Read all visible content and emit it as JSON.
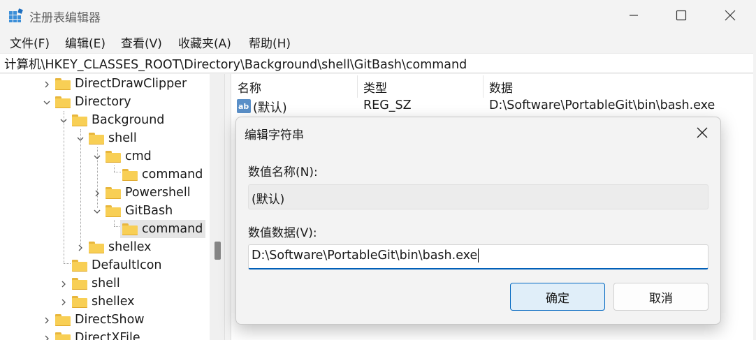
{
  "window": {
    "title": "注册表编辑器",
    "menu": [
      "文件(F)",
      "编辑(E)",
      "查看(V)",
      "收藏夹(A)",
      "帮助(H)"
    ],
    "address": "计算机\\HKEY_CLASSES_ROOT\\Directory\\Background\\shell\\GitBash\\command",
    "icons": {
      "app": "registry-editor-icon",
      "minimize": "minimize-icon",
      "maximize": "maximize-icon",
      "close": "close-icon"
    }
  },
  "tree": {
    "items": [
      {
        "label": "DirectDrawClipper",
        "depth": 0,
        "expander": "collapsed"
      },
      {
        "label": "Directory",
        "depth": 0,
        "expander": "expanded"
      },
      {
        "label": "Background",
        "depth": 1,
        "expander": "expanded"
      },
      {
        "label": "shell",
        "depth": 2,
        "expander": "expanded"
      },
      {
        "label": "cmd",
        "depth": 3,
        "expander": "expanded"
      },
      {
        "label": "command",
        "depth": 4,
        "expander": "none"
      },
      {
        "label": "Powershell",
        "depth": 3,
        "expander": "collapsed"
      },
      {
        "label": "GitBash",
        "depth": 3,
        "expander": "expanded"
      },
      {
        "label": "command",
        "depth": 4,
        "expander": "none",
        "selected": true
      },
      {
        "label": "shellex",
        "depth": 2,
        "expander": "collapsed"
      },
      {
        "label": "DefaultIcon",
        "depth": 1,
        "expander": "none"
      },
      {
        "label": "shell",
        "depth": 1,
        "expander": "collapsed"
      },
      {
        "label": "shellex",
        "depth": 1,
        "expander": "collapsed"
      },
      {
        "label": "DirectShow",
        "depth": 0,
        "expander": "collapsed"
      },
      {
        "label": "DirectXFile",
        "depth": 0,
        "expander": "collapsed"
      }
    ]
  },
  "list": {
    "columns": [
      "名称",
      "类型",
      "数据"
    ],
    "rows": [
      {
        "name": "(默认)",
        "type": "REG_SZ",
        "data": "D:\\Software\\PortableGit\\bin\\bash.exe",
        "icon": "string-value-icon"
      }
    ]
  },
  "dialog": {
    "title": "编辑字符串",
    "name_label": "数值名称(N):",
    "name_value": "(默认)",
    "data_label": "数值数据(V):",
    "data_value": "D:\\Software\\PortableGit\\bin\\bash.exe",
    "ok_label": "确定",
    "cancel_label": "取消"
  },
  "colors": {
    "accent": "#0067c0",
    "folder": "#f8cf55",
    "selection": "#e5e5e5"
  }
}
